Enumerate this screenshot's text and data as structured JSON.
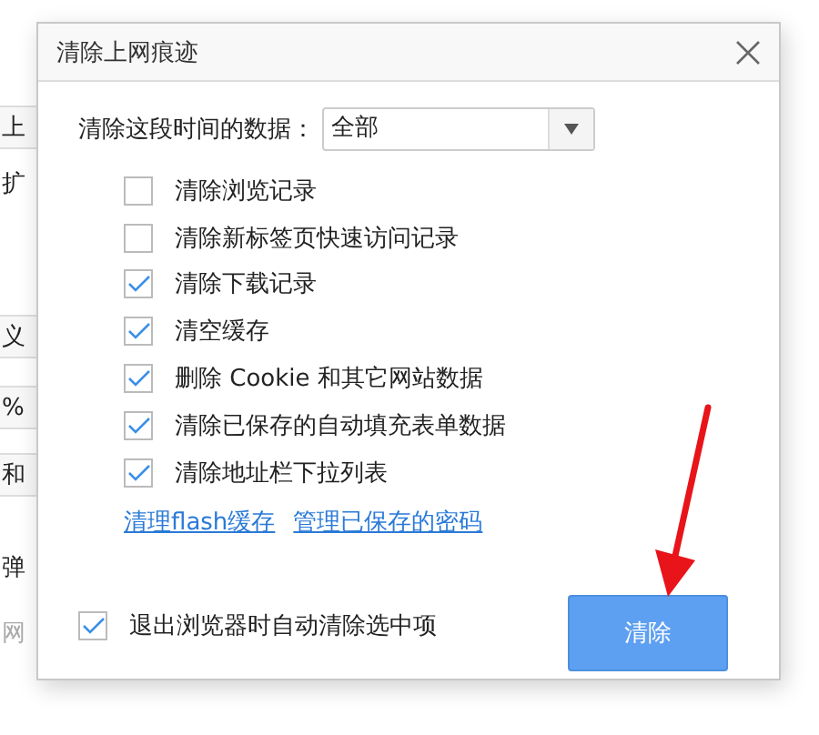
{
  "background_page": {
    "fragments": [
      {
        "text": "上",
        "boxed": true,
        "muted": false
      },
      {
        "text": "扩",
        "boxed": false,
        "muted": false
      },
      {
        "text": "义",
        "boxed": true,
        "muted": false
      },
      {
        "text": "%",
        "boxed": true,
        "muted": false
      },
      {
        "text": "和",
        "boxed": true,
        "muted": false
      },
      {
        "text": "弹",
        "boxed": false,
        "muted": false
      },
      {
        "text": "网",
        "boxed": false,
        "muted": true
      }
    ]
  },
  "dialog": {
    "title": "清除上网痕迹",
    "range_label": "清除这段时间的数据：",
    "range_select": {
      "value": "全部"
    },
    "options": [
      {
        "label": "清除浏览记录",
        "checked": false
      },
      {
        "label": "清除新标签页快速访问记录",
        "checked": false
      },
      {
        "label": "清除下载记录",
        "checked": true
      },
      {
        "label": "清空缓存",
        "checked": true
      },
      {
        "label": "删除 Cookie 和其它网站数据",
        "checked": true
      },
      {
        "label": "清除已保存的自动填充表单数据",
        "checked": true
      },
      {
        "label": "清除地址栏下拉列表",
        "checked": true
      }
    ],
    "links": [
      "清理flash缓存",
      "管理已保存的密码"
    ],
    "auto_clear": {
      "label": "退出浏览器时自动清除选中项",
      "checked": true
    },
    "clear_button": "清除"
  }
}
